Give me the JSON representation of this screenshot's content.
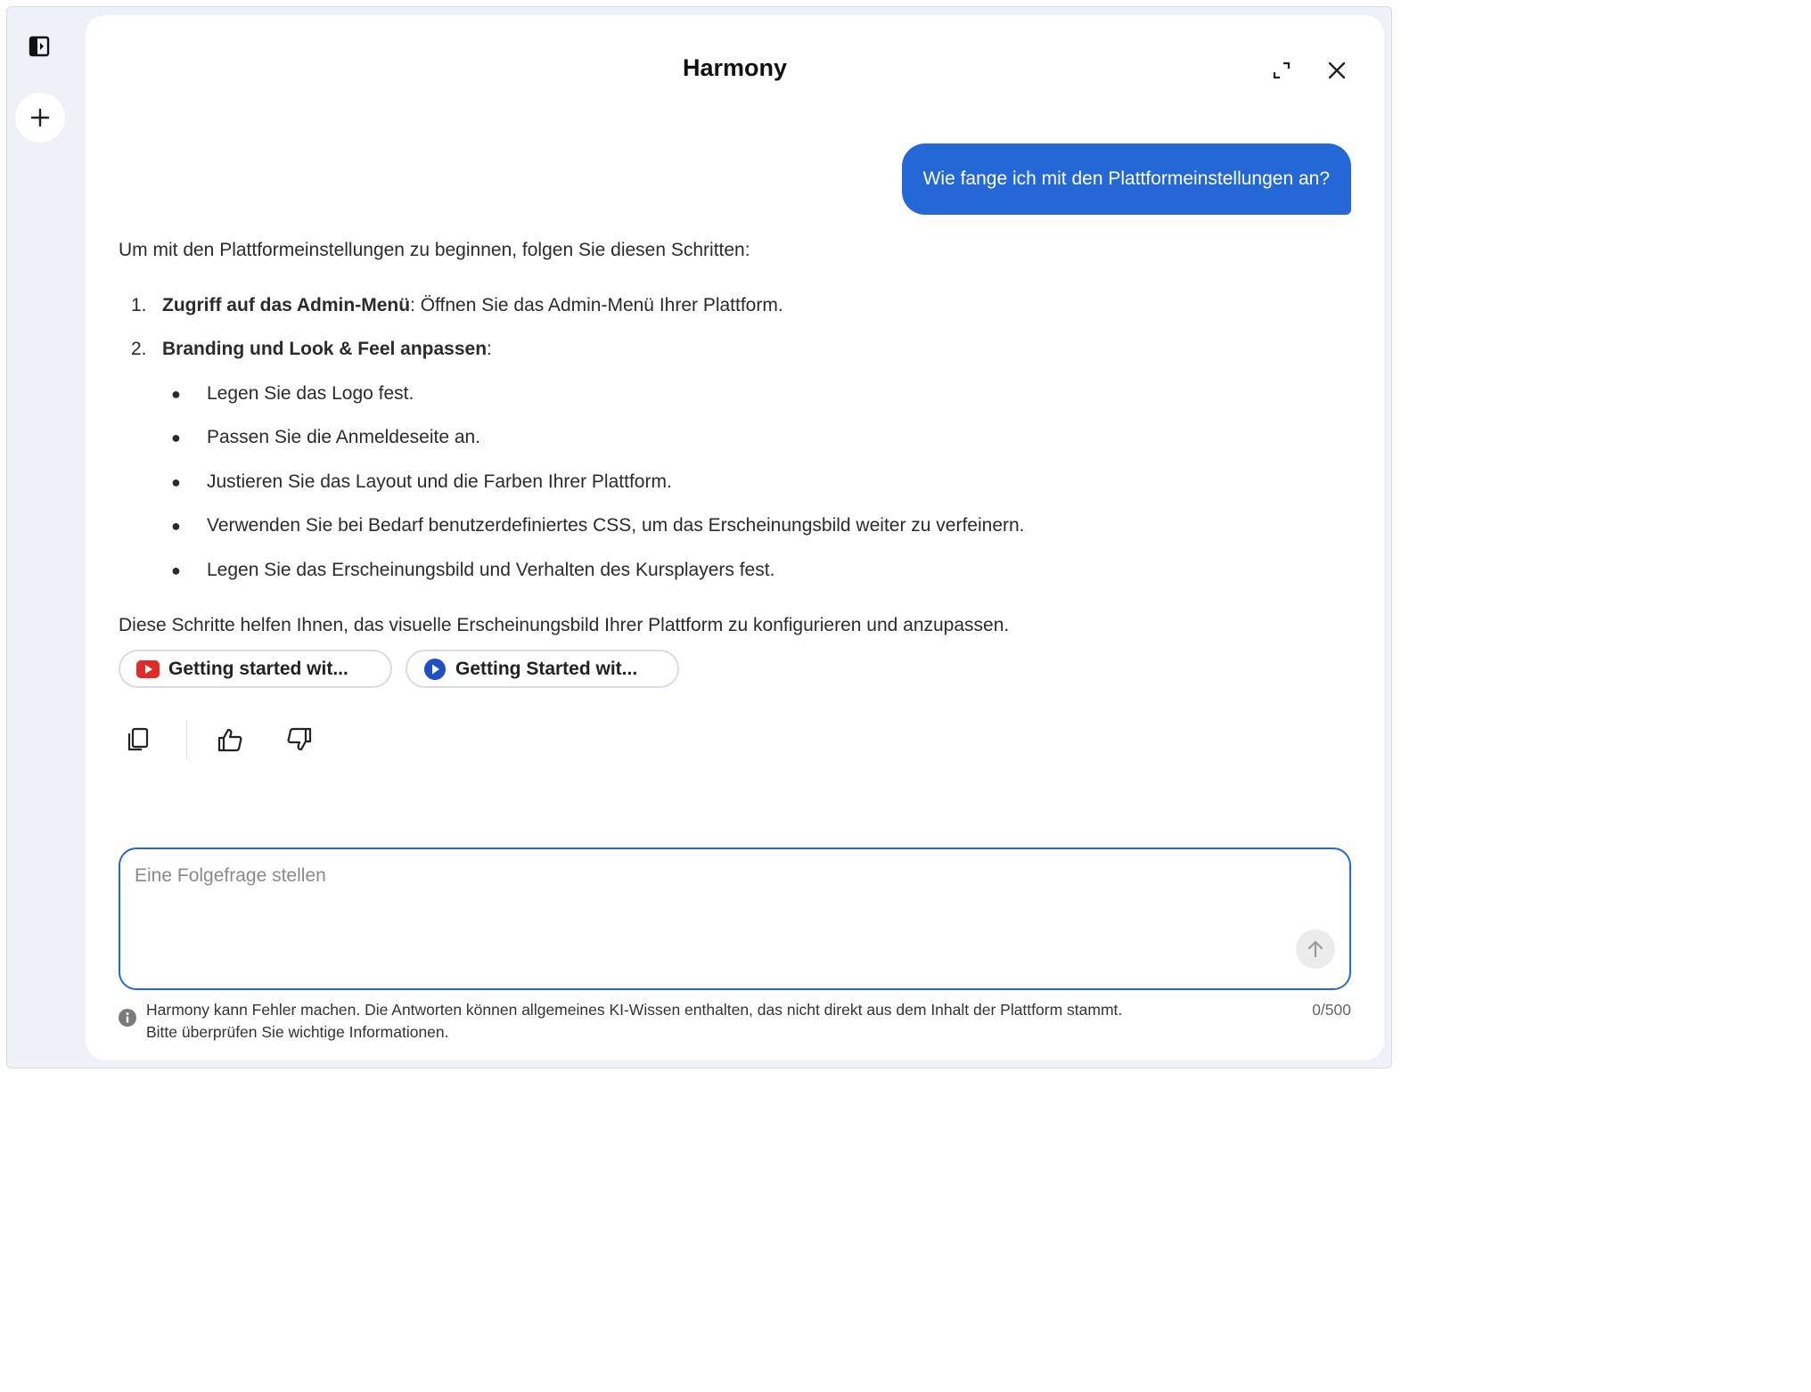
{
  "header": {
    "title": "Harmony",
    "expand_icon": "expand-icon",
    "close_icon": "close-icon"
  },
  "rail": {
    "toggle_icon": "sidebar-toggle-icon",
    "new_chat_icon": "plus-icon"
  },
  "conversation": {
    "user_message": "Wie fange ich mit den Plattformeinstellungen an?",
    "answer": {
      "intro": "Um mit den Plattformeinstellungen zu beginnen, folgen Sie diesen Schritten:",
      "steps": [
        {
          "num": "1.",
          "bold": "Zugriff auf das Admin-Menü",
          "rest": ": Öffnen Sie das Admin-Menü Ihrer Plattform."
        },
        {
          "num": "2.",
          "bold": "Branding und Look & Feel anpassen",
          "rest": ":"
        }
      ],
      "bullets": [
        "Legen Sie das Logo fest.",
        "Passen Sie die Anmeldeseite an.",
        "Justieren Sie das Layout und die Farben Ihrer Plattform.",
        "Verwenden Sie bei Bedarf benutzerdefiniertes CSS, um das Erscheinungsbild weiter zu verfeinern.",
        "Legen Sie das Erscheinungsbild und Verhalten des Kursplayers fest."
      ],
      "outro": "Diese Schritte helfen Ihnen, das visuelle Erscheinungsbild Ihrer Plattform zu konfigurieren und anzupassen."
    },
    "sources": [
      {
        "label": "Getting started wit...",
        "icon": "youtube-icon",
        "icon_color": "#e02b2b"
      },
      {
        "label": "Getting Started wit...",
        "icon": "play-circle-icon",
        "icon_color": "#1f4fc2"
      }
    ],
    "actions": {
      "copy_icon": "copy-icon",
      "like_icon": "thumbs-up-icon",
      "dislike_icon": "thumbs-down-icon"
    }
  },
  "composer": {
    "placeholder": "Eine Folgefrage stellen",
    "value": "",
    "send_icon": "arrow-up-icon",
    "counter": "0/500"
  },
  "disclaimer": {
    "icon": "info-icon",
    "line1": "Harmony kann Fehler machen. Die Antworten können allgemeines KI-Wissen enthalten, das nicht direkt aus dem Inhalt der Plattform stammt.",
    "line2": "Bitte überprüfen Sie wichtige Informationen."
  },
  "colors": {
    "accent": "#2467d6",
    "rail_background": "#eef1f8",
    "panel_background": "#ffffff"
  }
}
